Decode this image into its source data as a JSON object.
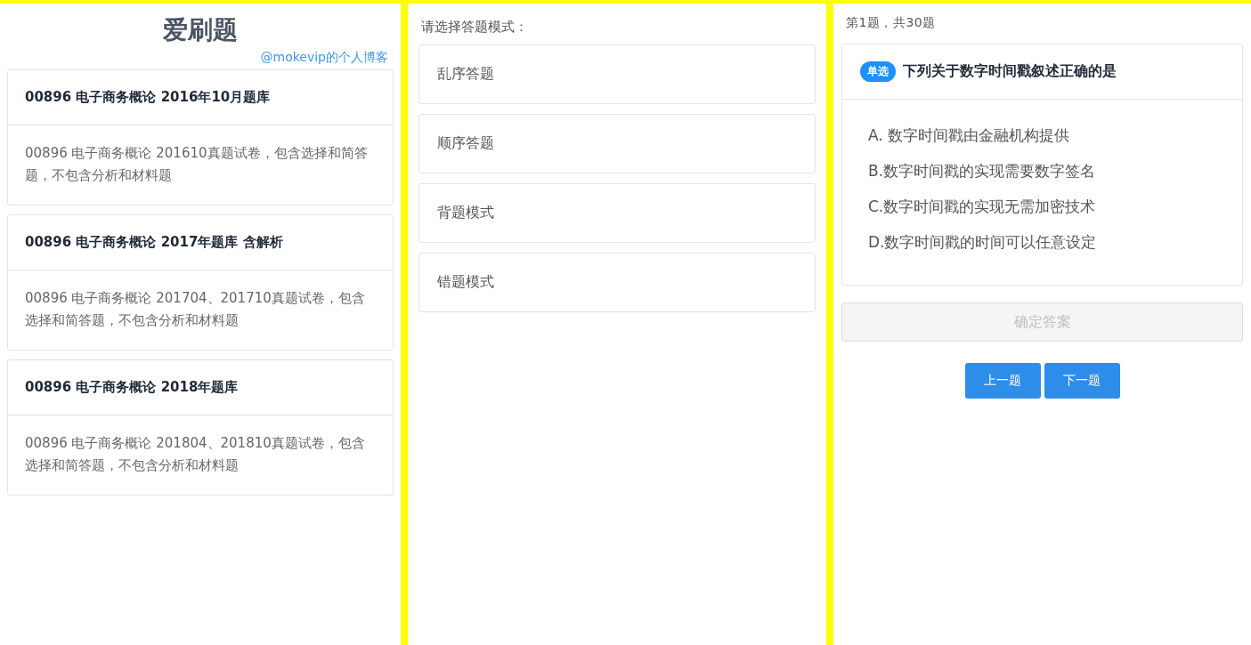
{
  "bank_panel": {
    "title": "爱刷题",
    "author_link": "@mokevip的个人博客",
    "banks": [
      {
        "name": "00896 电子商务概论 2016年10月题库",
        "description": "00896 电子商务概论 201610真题试卷，包含选择和简答题，不包含分析和材料题"
      },
      {
        "name": "00896 电子商务概论 2017年题库 含解析",
        "description": "00896 电子商务概论 201704、201710真题试卷，包含选择和简答题，不包含分析和材料题"
      },
      {
        "name": "00896 电子商务概论 2018年题库",
        "description": "00896 电子商务概论 201804、201810真题试卷，包含选择和简答题，不包含分析和材料题"
      }
    ]
  },
  "mode_panel": {
    "prompt": "请选择答题模式：",
    "modes": [
      "乱序答题",
      "顺序答题",
      "背题模式",
      "错题模式"
    ]
  },
  "question_panel": {
    "progress": "第1题，共30题",
    "question": {
      "type_badge": "单选",
      "text": "下列关于数字时间戳叙述正确的是",
      "options": [
        {
          "text": "A. 数字时间戳由金融机构提供",
          "selected": false
        },
        {
          "text": "B.数字时间戳的实现需要数字签名",
          "selected": false
        },
        {
          "text": "C.数字时间戳的实现无需加密技术",
          "selected": false
        },
        {
          "text": "D.数字时间戳的时间可以任意设定",
          "selected": false
        }
      ]
    },
    "submit_button": {
      "label": "确定答案",
      "disabled": true
    },
    "nav_buttons": [
      "上一题",
      "下一题"
    ]
  }
}
